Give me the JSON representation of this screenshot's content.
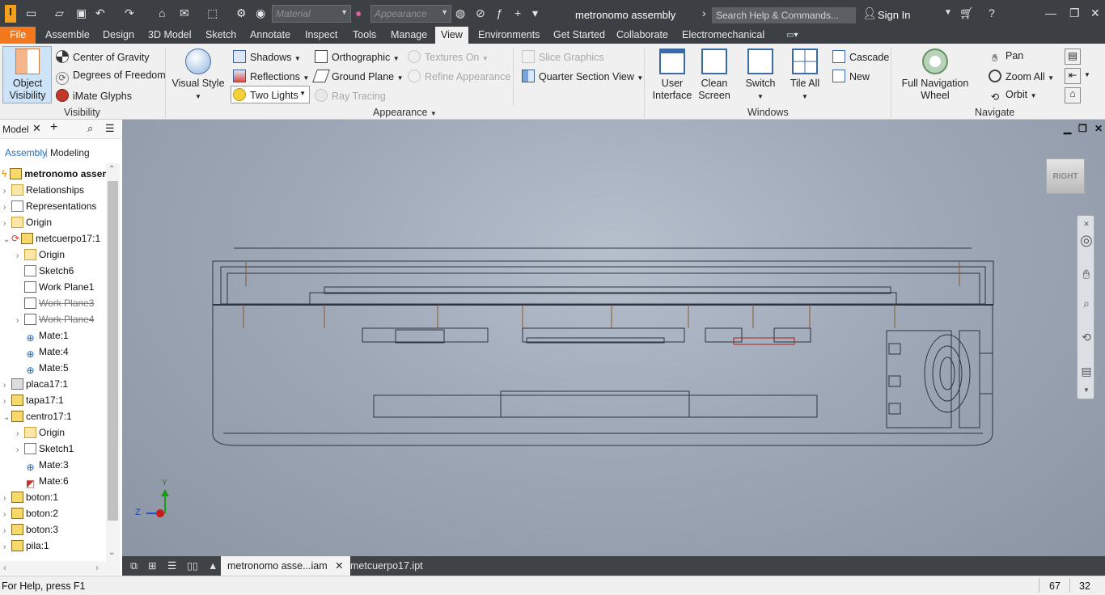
{
  "titlebar": {
    "app_logo": "I",
    "material_placeholder": "Material",
    "appearance_placeholder": "Appearance",
    "document_title": "metronomo assembly",
    "search_placeholder": "Search Help & Commands...",
    "sign_in": "Sign In"
  },
  "ribbon_tabs": [
    "File",
    "Assemble",
    "Design",
    "3D Model",
    "Sketch",
    "Annotate",
    "Inspect",
    "Tools",
    "Manage",
    "View",
    "Environments",
    "Get Started",
    "Collaborate",
    "Electromechanical"
  ],
  "active_tab": "View",
  "visibility": {
    "object_visibility": "Object Visibility",
    "center_of_gravity": "Center of Gravity",
    "degrees_of_freedom": "Degrees of Freedom",
    "imate_glyphs": "iMate Glyphs",
    "panel_label": "Visibility"
  },
  "appearance": {
    "visual_style": "Visual Style",
    "shadows": "Shadows",
    "reflections": "Reflections",
    "two_lights": "Two Lights",
    "orthographic": "Orthographic",
    "ground_plane": "Ground Plane",
    "ray_tracing": "Ray Tracing",
    "textures_on": "Textures On",
    "refine_appearance": "Refine Appearance",
    "slice_graphics": "Slice Graphics",
    "quarter_section_view": "Quarter Section View",
    "panel_label": "Appearance"
  },
  "windows": {
    "user_interface": "User Interface",
    "clean_screen": "Clean Screen",
    "switch": "Switch",
    "tile_all": "Tile All",
    "cascade": "Cascade",
    "new": "New",
    "panel_label": "Windows"
  },
  "navigate": {
    "full_navigation_wheel": "Full Navigation Wheel",
    "pan": "Pan",
    "zoom_all": "Zoom All",
    "orbit": "Orbit",
    "panel_label": "Navigate"
  },
  "browser": {
    "tab_label": "Model",
    "mode_assembly": "Assembly",
    "mode_modeling": "Modeling",
    "items": [
      {
        "label": "metronomo assembly",
        "level": 0,
        "icon": "assembly-icon",
        "bold": true
      },
      {
        "label": "Relationships",
        "level": 0,
        "icon": "folder-icon"
      },
      {
        "label": "Representations",
        "level": 0,
        "icon": "representations-icon"
      },
      {
        "label": "Origin",
        "level": 0,
        "icon": "folder-icon"
      },
      {
        "label": "metcuerpo17:1",
        "level": 0,
        "icon": "part-icon"
      },
      {
        "label": "Origin",
        "level": 1,
        "icon": "folder-icon"
      },
      {
        "label": "Sketch6",
        "level": 1,
        "icon": "sketch-icon"
      },
      {
        "label": "Work Plane1",
        "level": 1,
        "icon": "workplane-icon"
      },
      {
        "label": "Work Plane3",
        "level": 1,
        "icon": "workplane-icon",
        "strike": true
      },
      {
        "label": "Work Plane4",
        "level": 1,
        "icon": "workplane-icon",
        "strike": true
      },
      {
        "label": "Mate:1",
        "level": 1,
        "icon": "mate-icon"
      },
      {
        "label": "Mate:4",
        "level": 1,
        "icon": "mate-icon"
      },
      {
        "label": "Mate:5",
        "level": 1,
        "icon": "mate-icon"
      },
      {
        "label": "placa17:1",
        "level": 0,
        "icon": "part-icon"
      },
      {
        "label": "tapa17:1",
        "level": 0,
        "icon": "part-icon"
      },
      {
        "label": "centro17:1",
        "level": 0,
        "icon": "part-icon"
      },
      {
        "label": "Origin",
        "level": 1,
        "icon": "folder-icon"
      },
      {
        "label": "Sketch1",
        "level": 1,
        "icon": "sketch-icon"
      },
      {
        "label": "Mate:3",
        "level": 1,
        "icon": "mate-icon"
      },
      {
        "label": "Mate:6",
        "level": 1,
        "icon": "mate-icon"
      },
      {
        "label": "boton:1",
        "level": 0,
        "icon": "part-icon"
      },
      {
        "label": "boton:2",
        "level": 0,
        "icon": "part-icon"
      },
      {
        "label": "boton:3",
        "level": 0,
        "icon": "part-icon"
      },
      {
        "label": "pila:1",
        "level": 0,
        "icon": "part-icon"
      }
    ]
  },
  "viewport": {
    "viewcube_face": "RIGHT",
    "axis_y": "Y",
    "axis_z": "Z"
  },
  "document_tabs": [
    "metronomo asse...iam",
    "metcuerpo17.ipt"
  ],
  "status": {
    "help_text": "For Help, press F1",
    "count1": "67",
    "count2": "32"
  }
}
